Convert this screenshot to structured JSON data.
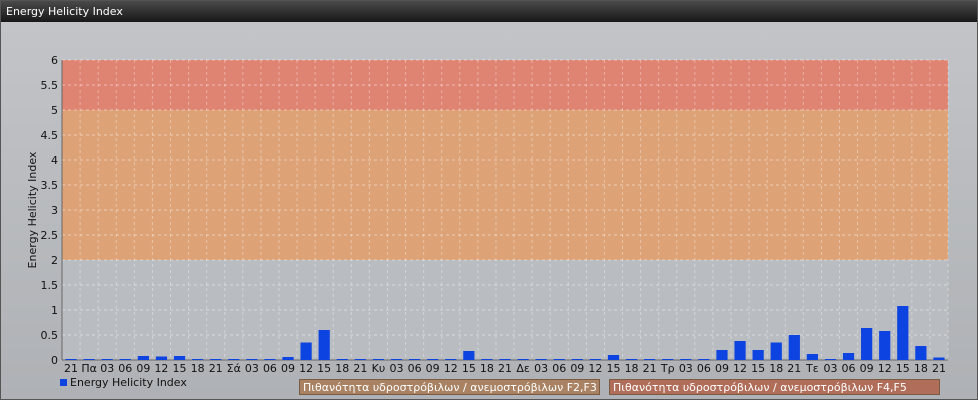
{
  "window": {
    "title": "Energy Helicity Index"
  },
  "colors": {
    "bar": "#0d43e0",
    "band_red": "#e0816f",
    "band_orange": "#e2a06b",
    "band_peach": "#d9a27a"
  },
  "chart_data": {
    "type": "bar",
    "title": "",
    "ylabel": "Energy Helicity Index",
    "ylim": [
      0,
      6
    ],
    "yticks": [
      "0",
      "0.5",
      "1",
      "1.5",
      "2",
      "2.5",
      "3",
      "3.5",
      "4",
      "4.5",
      "5",
      "5.5",
      "6"
    ],
    "grid": true,
    "bands": [
      {
        "from": 2,
        "to": 5,
        "color": "#e4a36b"
      },
      {
        "from": 5,
        "to": 6,
        "color": "#e5806d"
      }
    ],
    "categories": [
      "21",
      "Πα",
      "03",
      "06",
      "09",
      "12",
      "15",
      "18",
      "21",
      "Σά",
      "03",
      "06",
      "09",
      "12",
      "15",
      "18",
      "21",
      "Κυ",
      "03",
      "06",
      "09",
      "12",
      "15",
      "18",
      "21",
      "Δε",
      "03",
      "06",
      "09",
      "12",
      "15",
      "18",
      "21",
      "Τρ",
      "03",
      "06",
      "09",
      "12",
      "15",
      "18",
      "21",
      "Τε",
      "03",
      "06",
      "09",
      "12",
      "15",
      "18",
      "21"
    ],
    "series": [
      {
        "name": "Energy Helicity Index",
        "values": [
          0.02,
          0.02,
          0.02,
          0.02,
          0.08,
          0.07,
          0.08,
          0.02,
          0.02,
          0.02,
          0.02,
          0.02,
          0.06,
          0.35,
          0.6,
          0.02,
          0.02,
          0.02,
          0.02,
          0.02,
          0.02,
          0.02,
          0.18,
          0.02,
          0.02,
          0.02,
          0.02,
          0.02,
          0.02,
          0.02,
          0.1,
          0.02,
          0.02,
          0.02,
          0.02,
          0.02,
          0.2,
          0.38,
          0.2,
          0.35,
          0.5,
          0.12,
          0.02,
          0.14,
          0.64,
          0.58,
          1.08,
          0.28,
          0.05
        ]
      }
    ],
    "legend": "bottom-left"
  },
  "bands_legend": {
    "f23": "Πιθανότητα υδροστρόβιλων / ανεμοστρόβιλων F2,F3",
    "f45": "Πιθανότητα υδροστρόβιλων / ανεμοστρόβιλων F4,F5"
  }
}
